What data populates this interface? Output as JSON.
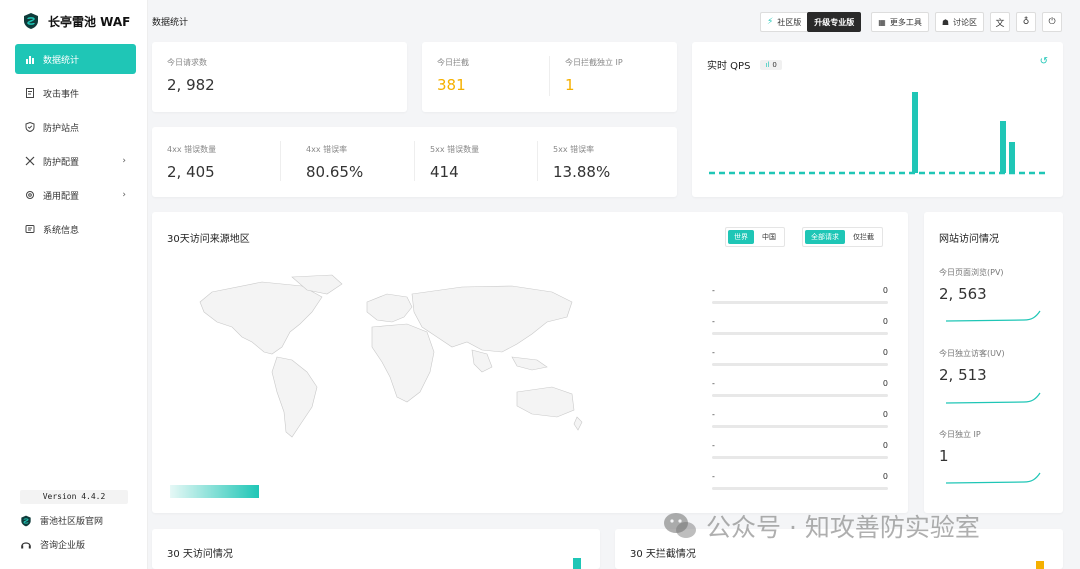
{
  "app": {
    "title": "长亭雷池 WAF"
  },
  "header": {
    "page_title": "数据统计"
  },
  "topbar": {
    "community_label": "社区版",
    "upgrade_label": "升级专业版",
    "more_tools_label": "更多工具",
    "forum_label": "讨论区"
  },
  "sidebar": {
    "items": [
      {
        "label": "数据统计",
        "icon": "bar-chart-icon"
      },
      {
        "label": "攻击事件",
        "icon": "document-icon"
      },
      {
        "label": "防护站点",
        "icon": "shield-icon"
      },
      {
        "label": "防护配置",
        "icon": "tools-icon"
      },
      {
        "label": "通用配置",
        "icon": "gear-icon"
      },
      {
        "label": "系统信息",
        "icon": "message-icon"
      }
    ],
    "version": "Version 4.4.2",
    "site_link": "雷池社区版官网",
    "enterprise_link": "咨询企业版"
  },
  "stats": {
    "requests": {
      "label": "今日请求数",
      "value": "2, 982"
    },
    "blocked": {
      "label": "今日拦截",
      "value": "381"
    },
    "blocked_ip": {
      "label": "今日拦截独立 IP",
      "value": "1"
    },
    "err4xx_count": {
      "label": "4xx 错误数量",
      "value": "2, 405"
    },
    "err4xx_rate": {
      "label": "4xx 错误率",
      "value": "80.65%"
    },
    "err5xx_count": {
      "label": "5xx 错误数量",
      "value": "414"
    },
    "err5xx_rate": {
      "label": "5xx 错误率",
      "value": "13.88%"
    }
  },
  "qps": {
    "title": "实时 QPS",
    "badge": "0"
  },
  "region": {
    "title": "30天访问来源地区",
    "scope_world": "世界",
    "scope_china": "中国",
    "filter_all": "全部请求",
    "filter_blocked": "仅拦截",
    "rows": [
      {
        "name": "-",
        "count": "0"
      },
      {
        "name": "-",
        "count": "0"
      },
      {
        "name": "-",
        "count": "0"
      },
      {
        "name": "-",
        "count": "0"
      },
      {
        "name": "-",
        "count": "0"
      },
      {
        "name": "-",
        "count": "0"
      },
      {
        "name": "-",
        "count": "0"
      }
    ]
  },
  "site_visits": {
    "title": "网站访问情况",
    "pv": {
      "label": "今日页面浏览(PV)",
      "value": "2, 563"
    },
    "uv": {
      "label": "今日独立访客(UV)",
      "value": "2, 513"
    },
    "ip": {
      "label": "今日独立 IP",
      "value": "1"
    }
  },
  "bottom": {
    "visits_title": "30 天访问情况",
    "blocked_title": "30 天拦截情况"
  },
  "watermark": {
    "text": "公众号 · 知攻善防实验室"
  },
  "colors": {
    "accent": "#1fc6b6",
    "orange": "#f5b000",
    "dark": "#2a2a2a"
  }
}
